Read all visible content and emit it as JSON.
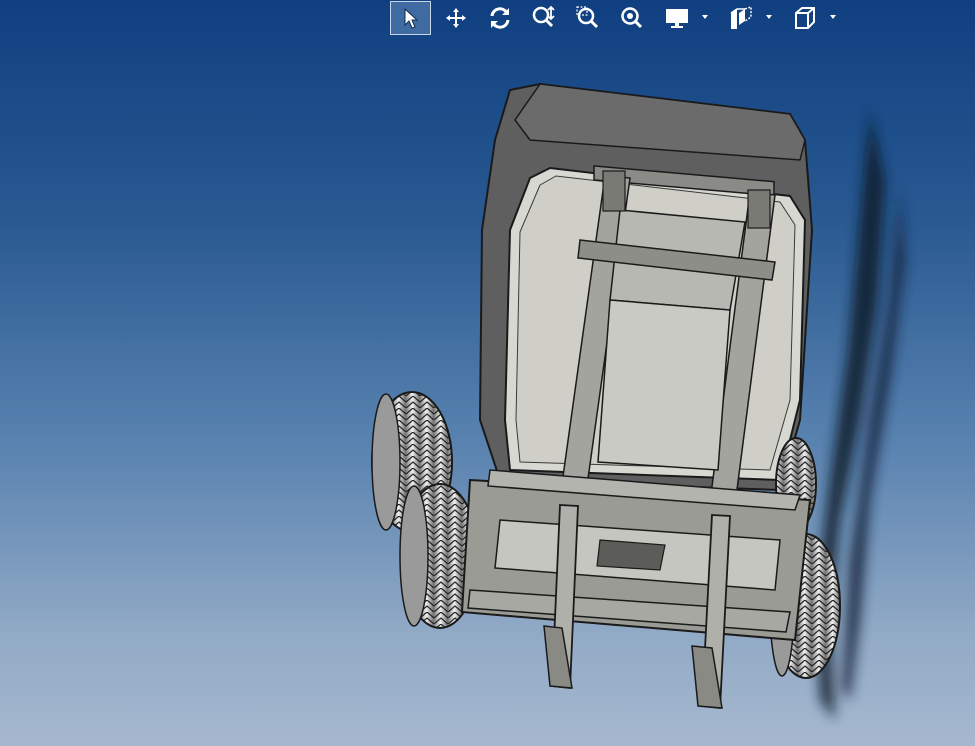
{
  "viewport": {
    "background_top": "#0f3f80",
    "background_bottom": "#a6b8cf"
  },
  "toolbar": {
    "buttons": [
      {
        "icon": "select-arrow-icon",
        "active": true
      },
      {
        "icon": "pan-move-icon",
        "active": false
      },
      {
        "icon": "rotate-icon",
        "active": false
      },
      {
        "icon": "zoom-in-out-icon",
        "active": false
      },
      {
        "icon": "zoom-window-icon",
        "active": false
      },
      {
        "icon": "zoom-fit-icon",
        "active": false
      },
      {
        "icon": "display-monitor-icon",
        "dropdown": true
      },
      {
        "icon": "section-view-icon",
        "dropdown": true
      },
      {
        "icon": "view-cube-icon",
        "dropdown": true
      }
    ]
  },
  "model": {
    "name": "forklift-3d-model",
    "body_color": "#5f5f5f",
    "panel_color": "#d8d8d2",
    "tire_color": "#c9c9c9",
    "shadow_color": "#0c1a2c"
  }
}
